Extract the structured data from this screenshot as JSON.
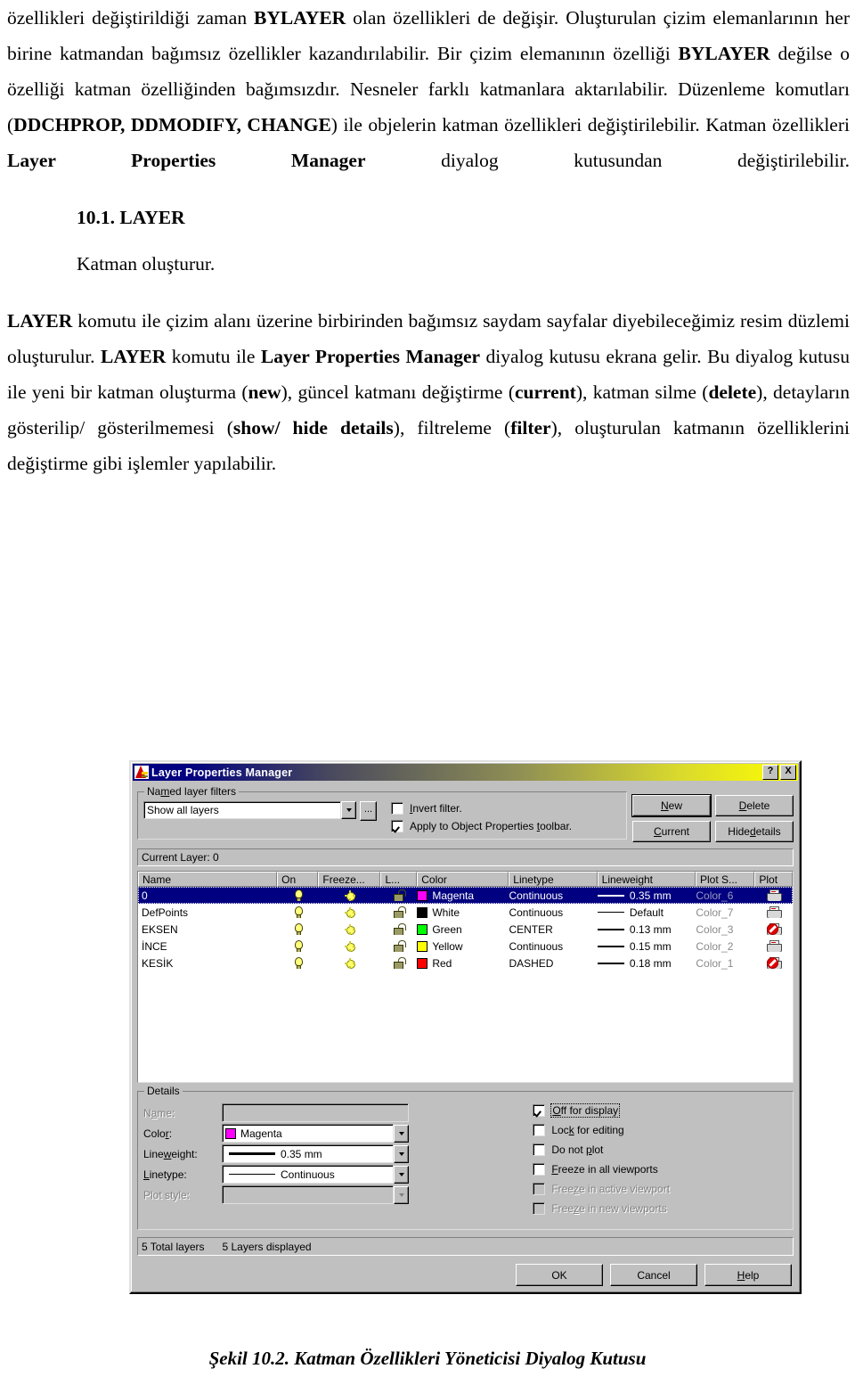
{
  "document": {
    "paragraphs": [
      {
        "id": "p1",
        "runs": [
          {
            "t": "özellikleri değiştirildiği zaman ",
            "b": false
          },
          {
            "t": "BYLAYER",
            "b": true
          },
          {
            "t": " olan özellikleri de değişir. Oluşturulan çizim elemanlarının her birine katmandan bağımsız özellikler kazandırılabilir. Bir çizim elemanının özelliği ",
            "b": false
          },
          {
            "t": "BYLAYER",
            "b": true
          },
          {
            "t": " değilse o özelliği katman özelliğinden bağımsızdır. Nesneler farklı katmanlara aktarılabilir. Düzenleme komutları (",
            "b": false
          },
          {
            "t": "DDCHPROP, DDMODIFY, CHANGE",
            "b": true
          },
          {
            "t": ") ile objelerin katman özellikleri değiştirilebilir. Katman özellikleri ",
            "b": false
          },
          {
            "t": "Layer Properties Manager",
            "b": true
          },
          {
            "t": " diyalog kutusundan değiştirilebilir.",
            "b": false
          }
        ]
      }
    ],
    "heading": "10.1. LAYER",
    "subtext": "Katman oluşturur.",
    "paragraph2": {
      "runs": [
        {
          "t": "LAYER",
          "b": true
        },
        {
          "t": " komutu ile çizim alanı üzerine birbirinden bağımsız saydam sayfalar diyebileceğimiz resim düzlemi oluşturulur. ",
          "b": false
        },
        {
          "t": "LAYER",
          "b": true
        },
        {
          "t": " komutu ile ",
          "b": false
        },
        {
          "t": "Layer Properties Manager",
          "b": true
        },
        {
          "t": " diyalog kutusu ekrana gelir. Bu diyalog kutusu ile yeni bir katman oluşturma (",
          "b": false
        },
        {
          "t": "new",
          "b": true
        },
        {
          "t": "), güncel katmanı değiştirme (",
          "b": false
        },
        {
          "t": "current",
          "b": true
        },
        {
          "t": "), katman silme (",
          "b": false
        },
        {
          "t": "delete",
          "b": true
        },
        {
          "t": "), detayların gösterilip/ gösterilmemesi (",
          "b": false
        },
        {
          "t": "show/ hide details",
          "b": true
        },
        {
          "t": "), filtreleme (",
          "b": false
        },
        {
          "t": "filter",
          "b": true
        },
        {
          "t": "), oluşturulan katmanın özelliklerini değiştirme gibi işlemler yapılabilir.",
          "b": false
        }
      ]
    },
    "figure_caption": "Şekil 10.2. Katman Özellikleri Yöneticisi Diyalog Kutusu"
  },
  "dialog": {
    "title": "Layer Properties Manager",
    "titlebar_buttons": {
      "help": "?",
      "close": "X"
    },
    "filters": {
      "legend_pre": "Na",
      "legend_key": "m",
      "legend_post": "ed layer filters",
      "selected": "Show all layers",
      "browse_label": "...",
      "invert": {
        "label_pre": "",
        "label_key": "I",
        "label_post": "nvert filter.",
        "checked": false
      },
      "apply": {
        "label_pre": "Apply to Object Properties ",
        "label_key": "t",
        "label_post": "oolbar.",
        "checked": true
      }
    },
    "buttons": {
      "new": {
        "pre": "",
        "key": "N",
        "post": "ew"
      },
      "delete": {
        "pre": "",
        "key": "D",
        "post": "elete"
      },
      "current": {
        "pre": "",
        "key": "C",
        "post": "urrent"
      },
      "hide_details": {
        "pre": "Hide ",
        "key": "d",
        "post": "etails"
      }
    },
    "current_layer": "Current Layer:  0",
    "list": {
      "columns": [
        "Name",
        "On",
        "Freeze...",
        "L...",
        "Color",
        "Linetype",
        "Lineweight",
        "Plot S...",
        "Plot"
      ],
      "rows": [
        {
          "name": "0",
          "on": "on",
          "freeze": "thawed",
          "lock": "unlocked",
          "color": "Magenta",
          "color_hex": "#ff00ff",
          "linetype": "Continuous",
          "lineweight": "0.35 mm",
          "plotstyle": "Color_6",
          "plot": "yes",
          "selected": true
        },
        {
          "name": "DefPoints",
          "on": "on",
          "freeze": "thawed",
          "lock": "unlocked",
          "color": "White",
          "color_hex": "#000000",
          "linetype": "Continuous",
          "lineweight": "Default",
          "plotstyle": "Color_7",
          "plot": "yes",
          "selected": false
        },
        {
          "name": "EKSEN",
          "on": "on",
          "freeze": "thawed",
          "lock": "unlocked",
          "color": "Green",
          "color_hex": "#00ff00",
          "linetype": "CENTER",
          "lineweight": "0.13 mm",
          "plotstyle": "Color_3",
          "plot": "no",
          "selected": false
        },
        {
          "name": "İNCE",
          "on": "on",
          "freeze": "thawed",
          "lock": "unlocked",
          "color": "Yellow",
          "color_hex": "#ffff00",
          "linetype": "Continuous",
          "lineweight": "0.15 mm",
          "plotstyle": "Color_2",
          "plot": "yes",
          "selected": false
        },
        {
          "name": "KESİK",
          "on": "on",
          "freeze": "thawed",
          "lock": "unlocked",
          "color": "Red",
          "color_hex": "#ff0000",
          "linetype": "DASHED",
          "lineweight": "0.18 mm",
          "plotstyle": "Color_1",
          "plot": "no",
          "selected": false
        }
      ]
    },
    "details": {
      "legend": "Details",
      "fields": {
        "name": {
          "pre": "N",
          "key": "a",
          "post": "me:",
          "value": "",
          "disabled": true
        },
        "color": {
          "pre": "Colo",
          "key": "r",
          "post": ":",
          "value": "Magenta",
          "swatch": "#ff00ff",
          "disabled": false
        },
        "lineweight": {
          "pre": "Line",
          "key": "w",
          "post": "eight:",
          "value": "0.35 mm",
          "disabled": false
        },
        "linetype": {
          "pre": "",
          "key": "L",
          "post": "inetype:",
          "value": "Continuous",
          "disabled": false
        },
        "plotstyle": {
          "pre": "Plot style:",
          "key": "",
          "post": "",
          "value": "",
          "disabled": true
        }
      },
      "checkboxes": [
        {
          "pre": "",
          "key": "O",
          "post": "ff for display",
          "checked": true,
          "disabled": false,
          "focus": true
        },
        {
          "pre": "Loc",
          "key": "k",
          "post": " for editing",
          "checked": false,
          "disabled": false,
          "focus": false
        },
        {
          "pre": "Do not ",
          "key": "p",
          "post": "lot",
          "checked": false,
          "disabled": false,
          "focus": false
        },
        {
          "pre": "",
          "key": "F",
          "post": "reeze in all viewports",
          "checked": false,
          "disabled": false,
          "focus": false
        },
        {
          "pre": "Free",
          "key": "z",
          "post": "e in active viewport",
          "checked": false,
          "disabled": true,
          "focus": false
        },
        {
          "pre": "Free",
          "key": "z",
          "post": "e in new viewports",
          "checked": false,
          "disabled": true,
          "focus": false
        }
      ]
    },
    "status": {
      "total": "5 Total layers",
      "displayed": "5 Layers displayed"
    },
    "footer_buttons": {
      "ok": {
        "pre": "OK",
        "key": "",
        "post": ""
      },
      "cancel": {
        "pre": "Cancel",
        "key": "",
        "post": ""
      },
      "help": {
        "pre": "",
        "key": "H",
        "post": "elp"
      }
    }
  },
  "colors": {
    "dialog_face": "#c0c0c0",
    "title_start": "#000080",
    "title_end": "#ffff00",
    "selection": "#000080",
    "magenta": "#ff00ff",
    "green": "#00ff00",
    "yellow": "#ffff00",
    "red": "#ff0000",
    "white_layer": "#000000"
  }
}
